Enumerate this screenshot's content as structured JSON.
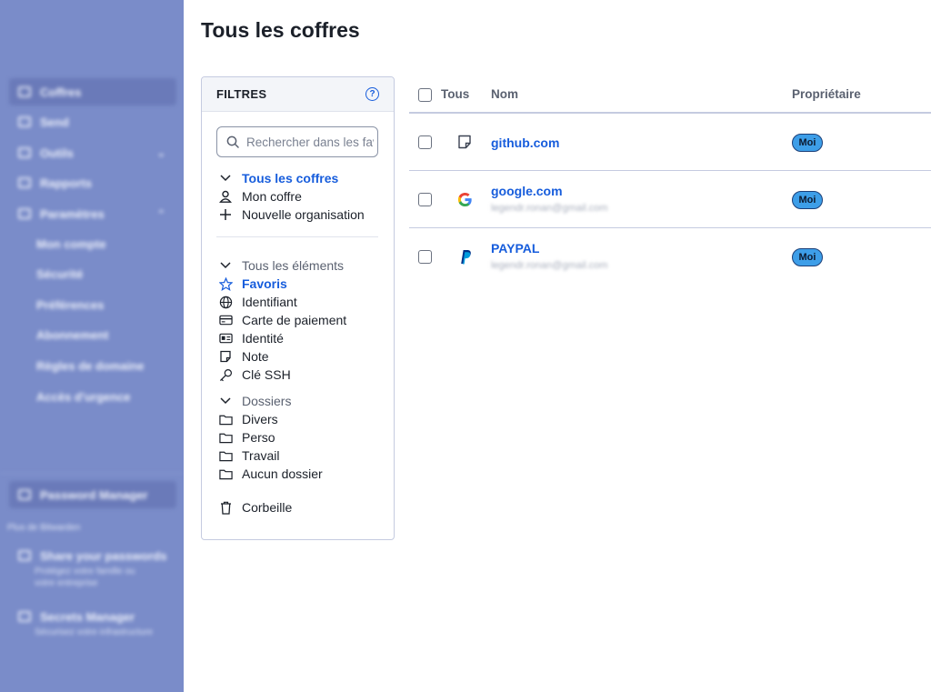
{
  "sidebar": {
    "items": [
      {
        "label": "Coffres"
      },
      {
        "label": "Send"
      },
      {
        "label": "Outils"
      },
      {
        "label": "Rapports"
      },
      {
        "label": "Paramètres"
      }
    ],
    "sub_items": [
      "Mon compte",
      "Sécurité",
      "Préférences",
      "Abonnement",
      "Règles de domaine",
      "Accès d'urgence"
    ],
    "product": "Password Manager",
    "more_label": "Plus de Bitwarden",
    "promos": [
      {
        "title": "Share your passwords",
        "desc": "Protégez votre famille ou votre entreprise"
      },
      {
        "title": "Secrets Manager",
        "desc": "Sécurisez votre infrastructure"
      }
    ],
    "collapse_glyph": "‹"
  },
  "page": {
    "title": "Tous les coffres"
  },
  "filters": {
    "title": "FILTRES",
    "search_placeholder": "Rechercher dans les favoris",
    "vaults_header": "Tous les coffres",
    "my_vault": "Mon coffre",
    "new_org": "Nouvelle organisation",
    "items_header": "Tous les éléments",
    "types": [
      "Favoris",
      "Identifiant",
      "Carte de paiement",
      "Identité",
      "Note",
      "Clé SSH"
    ],
    "folders_header": "Dossiers",
    "folders": [
      "Divers",
      "Perso",
      "Travail",
      "Aucun dossier"
    ],
    "trash": "Corbeille"
  },
  "table": {
    "col_all": "Tous",
    "col_name": "Nom",
    "col_owner": "Propriétaire",
    "rows": [
      {
        "name": "github.com",
        "sub": "",
        "owner": "Moi",
        "icon": "note-icon"
      },
      {
        "name": "google.com",
        "sub": "legendr.ronan@gmail.com",
        "owner": "Moi",
        "icon": "google-icon"
      },
      {
        "name": "PAYPAL",
        "sub": "legendr.ronan@gmail.com",
        "owner": "Moi",
        "icon": "paypal-icon"
      }
    ]
  },
  "colors": {
    "accent": "#175ddc",
    "sidebar": "#7a8cc9",
    "badge": "#3d9ee8"
  }
}
